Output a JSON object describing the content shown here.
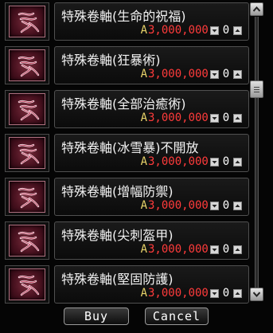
{
  "shop": {
    "items": [
      {
        "name": "特殊卷軸(生命的祝福)",
        "currency": "A",
        "price": "3,000,000",
        "qty": "0",
        "icon": "scroll-icon"
      },
      {
        "name": "特殊卷軸(狂暴術)",
        "currency": "A",
        "price": "3,000,000",
        "qty": "0",
        "icon": "scroll-icon"
      },
      {
        "name": "特殊卷軸(全部治癒術)",
        "currency": "A",
        "price": "3,000,000",
        "qty": "0",
        "icon": "scroll-icon"
      },
      {
        "name": "特殊卷軸(冰雪暴)不開放",
        "currency": "A",
        "price": "3,000,000",
        "qty": "0",
        "icon": "scroll-icon"
      },
      {
        "name": "特殊卷軸(增幅防禦)",
        "currency": "A",
        "price": "3,000,000",
        "qty": "0",
        "icon": "scroll-icon"
      },
      {
        "name": "特殊卷軸(尖刺盔甲)",
        "currency": "A",
        "price": "3,000,000",
        "qty": "0",
        "icon": "scroll-icon"
      },
      {
        "name": "特殊卷軸(堅固防護)",
        "currency": "A",
        "price": "3,000,000",
        "qty": "0",
        "icon": "scroll-icon"
      }
    ],
    "buy_label": "Buy",
    "cancel_label": "Cancel"
  },
  "colors": {
    "price": "#ff3b3b",
    "currency": "#e8d36a",
    "text": "#f2f2f2",
    "icon_bg": "#4a1220"
  }
}
